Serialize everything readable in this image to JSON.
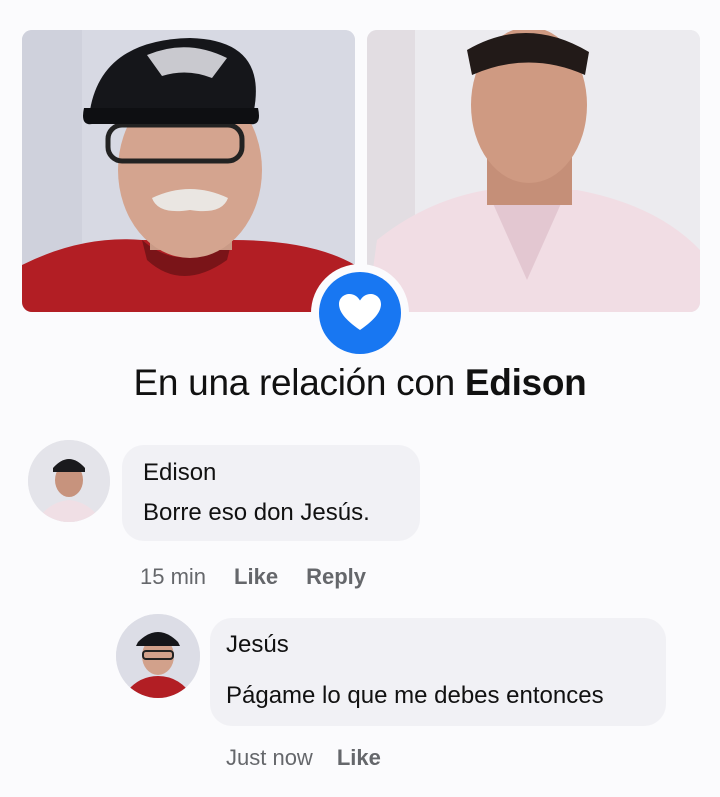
{
  "relationship": {
    "prefix": "En una relación con",
    "partner": "Edison"
  },
  "comments": [
    {
      "author": "Edison",
      "text": "Borre eso don Jesús.",
      "time": "15 min",
      "actions": [
        "Like",
        "Reply"
      ]
    },
    {
      "author": "Jesús",
      "text": "Págame lo que me debes entonces",
      "time": "Just now",
      "actions": [
        "Like"
      ]
    }
  ],
  "colors": {
    "accent": "#1877f2",
    "meta_text": "#65676b",
    "bubble": "#f1f1f5"
  },
  "icons": {
    "relationship": "heart-icon"
  }
}
